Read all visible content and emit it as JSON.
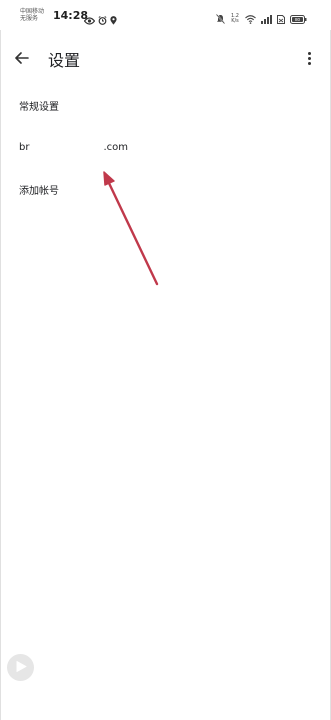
{
  "status_bar": {
    "carrier_line1": "中国移动",
    "carrier_line2": "无服务",
    "time": "14:28",
    "net_speed_value": "1.2",
    "net_speed_unit": "K/s",
    "battery_level": "80",
    "icons_left": [
      "eye-icon",
      "alarm-icon",
      "location-icon"
    ],
    "icons_right": [
      "mute-icon",
      "wifi-icon",
      "signal-icon",
      "sim-icon",
      "battery-icon"
    ]
  },
  "toolbar": {
    "title": "设置",
    "back_icon": "arrow-back-icon",
    "more_icon": "more-vert-icon"
  },
  "settings_list": {
    "general": "常规设置",
    "account_prefix": "br",
    "account_suffix": ".com",
    "add_account": "添加帐号"
  },
  "annotation": {
    "arrow_color": "#c0394b"
  },
  "floating_button": {
    "icon": "play-triangle-icon"
  }
}
